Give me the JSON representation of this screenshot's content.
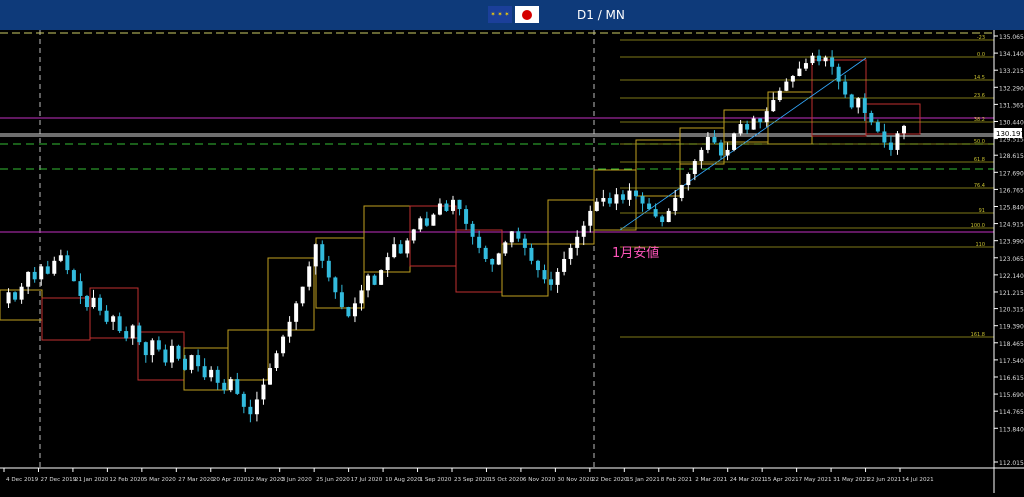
{
  "window": {
    "title": "D1 / MN",
    "icons": [
      "eu-flag-icon",
      "japan-flag-icon"
    ]
  },
  "annotation": {
    "text": "1月安値"
  },
  "chart_data": {
    "type": "candlestick",
    "ylim": [
      112.015,
      135.065
    ],
    "y_ticks": [
      "135.065",
      "134.140",
      "133.215",
      "132.290",
      "131.365",
      "130.440",
      "129.515",
      "128.615",
      "127.690",
      "126.765",
      "125.840",
      "124.915",
      "123.990",
      "123.065",
      "122.140",
      "121.215",
      "120.315",
      "119.390",
      "118.465",
      "117.540",
      "116.615",
      "115.690",
      "114.765",
      "113.840",
      "112.015"
    ],
    "x_labels": [
      "4 Dec 2019",
      "27 Dec 2019",
      "21 Jan 2020",
      "12 Feb 2020",
      "5 Mar 2020",
      "27 Mar 2020",
      "20 Apr 2020",
      "12 May 2020",
      "3 Jun 2020",
      "25 Jun 2020",
      "17 Jul 2020",
      "10 Aug 2020",
      "1 Sep 2020",
      "23 Sep 2020",
      "15 Oct 2020",
      "6 Nov 2020",
      "30 Nov 2020",
      "22 Dec 2020",
      "15 Jan 2021",
      "8 Feb 2021",
      "2 Mar 2021",
      "24 Mar 2021",
      "15 Apr 2021",
      "7 May 2021",
      "31 May 2021",
      "22 Jun 2021",
      "14 Jul 2021"
    ],
    "current_price": "130.197",
    "fib_levels": [
      "-23",
      "0.0",
      "14.5",
      "23.6",
      "38.2",
      "50.0",
      "61.8",
      "76.4",
      "91",
      "100.0",
      "110",
      "161.8"
    ],
    "price_path": [
      120.6,
      121.2,
      120.8,
      121.5,
      122.3,
      121.9,
      122.6,
      122.2,
      122.9,
      123.2,
      122.4,
      121.8,
      121.0,
      120.4,
      120.9,
      120.2,
      119.6,
      119.9,
      119.1,
      118.7,
      119.4,
      118.5,
      117.8,
      118.6,
      118.1,
      117.4,
      118.3,
      117.6,
      117.0,
      117.8,
      117.2,
      116.6,
      117.0,
      116.3,
      115.9,
      116.5,
      115.7,
      115.0,
      114.6,
      115.4,
      116.2,
      117.1,
      117.9,
      118.8,
      119.6,
      120.6,
      121.5,
      122.6,
      123.8,
      122.9,
      122.0,
      121.2,
      120.4,
      119.9,
      120.6,
      121.3,
      122.1,
      121.6,
      122.4,
      123.1,
      123.8,
      123.3,
      124.0,
      124.6,
      125.2,
      124.8,
      125.4,
      126.0,
      125.6,
      126.2,
      125.7,
      124.9,
      124.2,
      123.6,
      123.0,
      122.7,
      123.3,
      123.9,
      124.5,
      124.1,
      123.6,
      122.9,
      122.4,
      121.9,
      121.6,
      122.3,
      123.0,
      123.6,
      124.2,
      124.8,
      125.6,
      126.1,
      126.3,
      126.0,
      126.5,
      126.2,
      126.7,
      126.4,
      126.0,
      125.7,
      125.3,
      125.0,
      125.6,
      126.3,
      127.0,
      127.6,
      128.3,
      128.9,
      129.6,
      129.3,
      128.6,
      128.9,
      129.8,
      130.3,
      130.0,
      130.6,
      130.4,
      131.0,
      131.6,
      132.1,
      132.6,
      132.9,
      133.3,
      133.6,
      134.0,
      133.7,
      133.9,
      133.4,
      132.6,
      131.9,
      131.2,
      131.7,
      130.9,
      130.4,
      129.9,
      129.3,
      128.9,
      129.8,
      130.2
    ]
  }
}
